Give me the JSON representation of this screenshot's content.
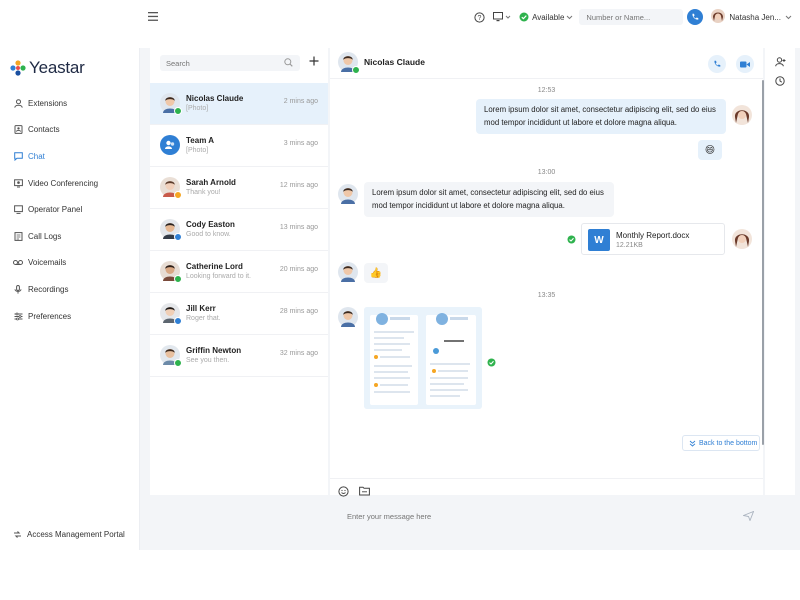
{
  "brand": {
    "name": "Yeastar"
  },
  "nav": {
    "items": [
      {
        "label": "Extensions",
        "icon": "user-icon"
      },
      {
        "label": "Contacts",
        "icon": "contacts-icon"
      },
      {
        "label": "Chat",
        "icon": "chat-icon",
        "active": true
      },
      {
        "label": "Video Conferencing",
        "icon": "video-conference-icon"
      },
      {
        "label": "Operator Panel",
        "icon": "operator-panel-icon"
      },
      {
        "label": "Call Logs",
        "icon": "call-logs-icon"
      },
      {
        "label": "Voicemails",
        "icon": "voicemail-icon"
      },
      {
        "label": "Recordings",
        "icon": "microphone-icon"
      },
      {
        "label": "Preferences",
        "icon": "preferences-icon"
      }
    ],
    "footer": "Access Management Portal"
  },
  "topbar": {
    "status": "Available",
    "dial_placeholder": "Number or Name...",
    "user_name": "Natasha Jen..."
  },
  "list": {
    "search_placeholder": "Search",
    "conversations": [
      {
        "name": "Nicolas Claude",
        "preview": "[Photo]",
        "time": "2 mins ago",
        "presence": "available"
      },
      {
        "name": "Team A",
        "preview": "[Photo]",
        "time": "3 mins ago",
        "presence": "none"
      },
      {
        "name": "Sarah Arnold",
        "preview": "Thank you!",
        "time": "12 mins ago",
        "presence": "away"
      },
      {
        "name": "Cody Easton",
        "preview": "Good to know.",
        "time": "13 mins ago",
        "presence": "busy"
      },
      {
        "name": "Catherine Lord",
        "preview": "Looking forward to it.",
        "time": "20 mins ago",
        "presence": "available"
      },
      {
        "name": "Jill Kerr",
        "preview": "Roger that.",
        "time": "28 mins ago",
        "presence": "busy"
      },
      {
        "name": "Griffin Newton",
        "preview": "See you then.",
        "time": "32 mins ago",
        "presence": "available"
      }
    ]
  },
  "chat": {
    "title": "Nicolas Claude",
    "timestamps": [
      "12:53",
      "13:00",
      "13:35"
    ],
    "messages": {
      "out_text": "Lorem ipsum dolor sit amet, consectetur adipiscing elit, sed do eius",
      "out_text_2": "mod tempor incididunt ut labore et dolore magna aliqua.",
      "in_text": "Lorem ipsum dolor sit amet, consectetur adipiscing elit, sed do eius",
      "in_text_2": "mod tempor incididunt ut labore et dolore magna aliqua.",
      "out_emoji": "😄",
      "in_emoji": "👍"
    },
    "file": {
      "name": "Monthly Report.docx",
      "size": "12.21KB",
      "icon_letter": "W"
    },
    "back_to_bottom": "Back to the bottom",
    "compose_placeholder": "Enter your message here"
  },
  "colors": {
    "accent": "#2f7fd4",
    "available": "#2eb24d",
    "away": "#f5a623",
    "busy": "#2f7fd4"
  }
}
